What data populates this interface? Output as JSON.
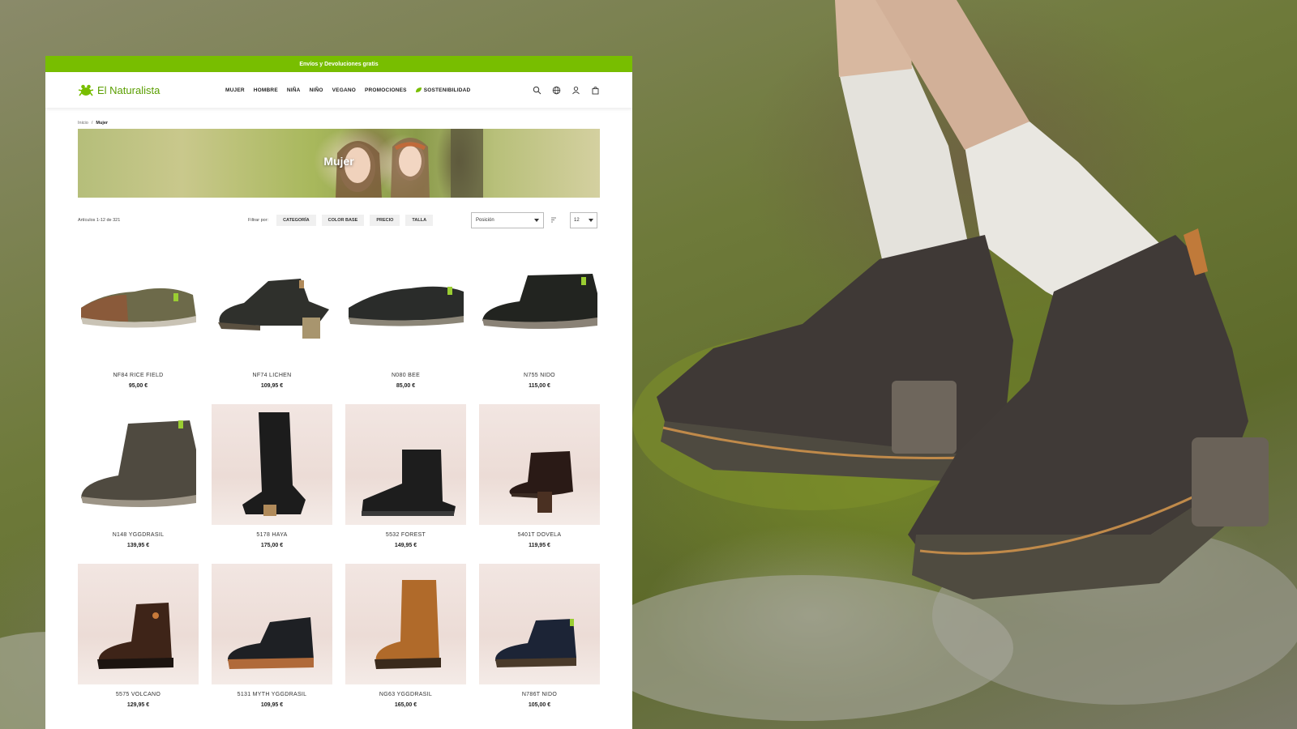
{
  "promo_bar": {
    "text": "Envíos y Devoluciones gratis"
  },
  "brand": {
    "name": "El Naturalista",
    "accent": "#78be00"
  },
  "nav": [
    "MUJER",
    "HOMBRE",
    "NIÑA",
    "NIÑO",
    "VEGANO",
    "PROMOCIONES",
    "SOSTENIBILIDAD"
  ],
  "header_icons": [
    "search-icon",
    "globe-icon",
    "user-icon",
    "cart-icon"
  ],
  "breadcrumb": {
    "home": "Inicio",
    "separator": "/",
    "current": "Mujer"
  },
  "hero": {
    "title": "Mujer"
  },
  "toolbar": {
    "count": "Artículos 1-12 de 321",
    "filter_label": "Filtrar por:",
    "filters": [
      "CATEGORÍA",
      "COLOR BASE",
      "PRECIO",
      "TALLA"
    ],
    "sort_value": "Posición",
    "limit_value": "12"
  },
  "products": [
    {
      "name": "NF84 RICE FIELD",
      "price": "95,00 €"
    },
    {
      "name": "NF74 LICHEN",
      "price": "109,95 €"
    },
    {
      "name": "N080 BEE",
      "price": "85,00 €"
    },
    {
      "name": "N755 NIDO",
      "price": "115,00 €"
    },
    {
      "name": "N148 YGGDRASIL",
      "price": "139,95 €"
    },
    {
      "name": "5178 HAYA",
      "price": "175,00 €"
    },
    {
      "name": "5532 FOREST",
      "price": "149,95 €"
    },
    {
      "name": "5401T DOVELA",
      "price": "119,95 €"
    },
    {
      "name": "5575 VOLCANO",
      "price": "129,95 €"
    },
    {
      "name": "5131 MYTH YGGDRASIL",
      "price": "109,95 €"
    },
    {
      "name": "NG63 YGGDRASIL",
      "price": "165,00 €"
    },
    {
      "name": "N786T NIDO",
      "price": "105,00 €"
    }
  ]
}
